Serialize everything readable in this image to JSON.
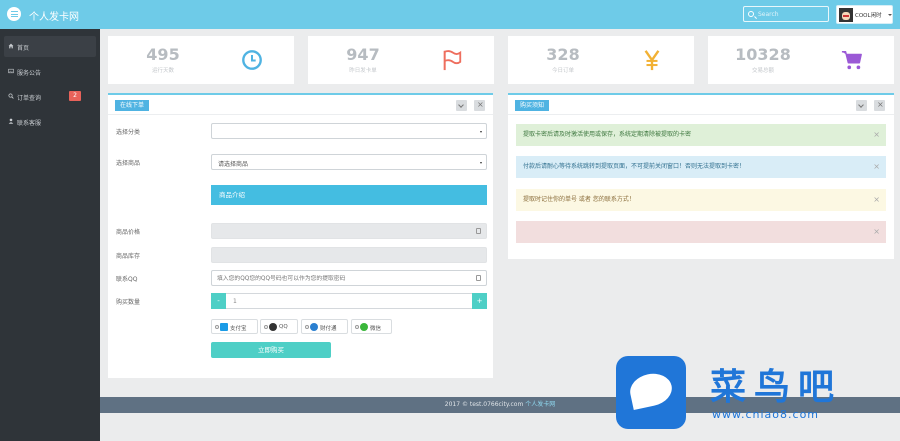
{
  "header": {
    "brand": "个人发卡网",
    "search_placeholder": "Search",
    "user_name": "COOL闲时"
  },
  "sidebar": {
    "items": [
      {
        "label": "首页",
        "icon": "home-icon"
      },
      {
        "label": "服务公告",
        "icon": "image-icon"
      },
      {
        "label": "订单查询",
        "icon": "search-icon",
        "badge": "2"
      },
      {
        "label": "联系客服",
        "icon": "user-icon"
      }
    ]
  },
  "stats": [
    {
      "value": "495",
      "label": "运行天数",
      "icon": "clock-icon",
      "color": "#4fb3e2"
    },
    {
      "value": "947",
      "label": "昨日发卡单",
      "icon": "flag-icon",
      "color": "#ee6e5e"
    },
    {
      "value": "328",
      "label": "今日订单",
      "icon": "yen-icon",
      "color": "#f2b134"
    },
    {
      "value": "10328",
      "label": "交易总额",
      "icon": "cart-icon",
      "color": "#9b59d6"
    }
  ],
  "order_panel": {
    "tag": "在线下单",
    "category_label": "选择分类",
    "category_value": "",
    "product_label": "选择商品",
    "product_value": "请选择商品",
    "info_bar": "商品介绍",
    "price_label": "商品价格",
    "stock_label": "商品库存",
    "qq_label": "联系QQ",
    "qq_placeholder": "填入您的QQ您的QQ号码也可以作为您的提取密码",
    "quantity_label": "购买数量",
    "quantity_value": "1",
    "minus_label": "-",
    "plus_label": "+",
    "payments": [
      {
        "label": "支付宝",
        "color": "#1a9be6"
      },
      {
        "label": "QQ",
        "color": "#333333"
      },
      {
        "label": "财付通",
        "color": "#2a7fd0"
      },
      {
        "label": "微信",
        "color": "#3ab63a"
      }
    ],
    "submit_label": "立即购买"
  },
  "notice_panel": {
    "tag": "购买须知",
    "alerts": [
      {
        "text": "提取卡密后请及时激活使用或保存，系统定期清除被提取的卡密",
        "bg": "#dff0d8",
        "color": "#3c763d"
      },
      {
        "text": "付款后请耐心等待系统跳转到提取页面，不可提前关闭窗口！否则无法提取到卡密！",
        "bg": "#d9edf7",
        "color": "#31708f"
      },
      {
        "text": "提取时记住你的单号 或者 您的联系方式！",
        "bg": "#fcf8e3",
        "color": "#8a6d3b"
      },
      {
        "text": "",
        "bg": "#f2dede",
        "color": "#a94442"
      }
    ]
  },
  "footer": {
    "copyright": "2017 © test.0766city.com",
    "link": "个人发卡网"
  },
  "watermark": {
    "title": "菜鸟吧",
    "url": "www.cniao8.com"
  }
}
